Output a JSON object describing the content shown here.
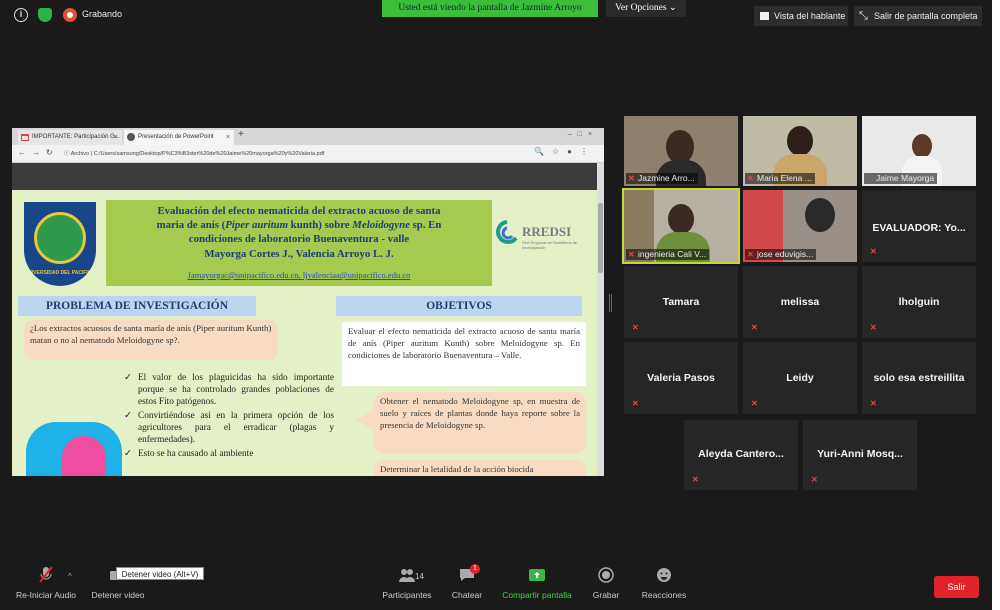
{
  "topbar": {
    "recording_label": "Grabando",
    "share_banner": "Usted está viendo la pantalla de Jazmine Arroyo",
    "view_options": "Ver Opciones",
    "speaker_view": "Vista del hablante",
    "exit_fullscreen": "Salir de pantalla completa"
  },
  "browser": {
    "tabs": [
      {
        "label": "IMPORTANTE: Participación G..."
      },
      {
        "label": "Presentación de PowerPoint"
      }
    ],
    "url_prefix": "Archivo",
    "url": "C:/Users/samsung/Desktop/P%C3%B3ster%20de%20Jaime%20mayorga%20y%20Valeria.pdf"
  },
  "poster": {
    "logo_text": "UNIVERSIDAD DEL PACIFICO",
    "title_line1": "Evaluación del efecto nematicida del extracto acuoso de santa",
    "title_line2_pre": "maria de anís (",
    "title_line2_em": "Piper auritum",
    "title_line2_mid": " kunth) sobre ",
    "title_line2_em2": "Meloidogyne",
    "title_line2_post": " sp. En",
    "title_line3": "condiciones de laboratorio Buenaventura - valle",
    "title_line4": "Mayorga Cortes J., Valencia Arroyo L. J.",
    "emails": "Jamayorgac@unipacifico.edu.co, ljvalenciaa@unipacifico.edu.co",
    "partner_logo": "RREDSI",
    "partner_sub": "Red Regional de Semilleros de Investigación",
    "problem_heading": "PROBLEMA DE INVESTIGACIÓN",
    "objectives_heading": "OBJETIVOS",
    "question": "¿Los extractos acuosos de santa maría de anís (Piper auritum Kunth) matan o no al nematodo Meloidogyne sp?.",
    "bullets": [
      "El valor de los plaguicidas ha sido importante porque se ha controlado grandes poblaciones de estos Fito patógenos.",
      "Convirtiéndose así en la primera opción de los agricultores para el erradicar (plagas y enfermedades).",
      "Esto se ha causado al ambiente"
    ],
    "objective_general": "Evaluar el efecto nematicida del extracto acuoso de santa maría de anís (Piper auritum Kunth) sobre Meloidogyne sp. En condiciones de laboratorio Buenaventura – Valle.",
    "objective_1": "Obtener el nematodo Meloidogyne sp, en muestra de suelo y raíces de plantas donde haya reporte sobre la presencia de Meloidogyne sp.",
    "objective_2": "Determinar la letalidad de la acción biocida"
  },
  "participants": {
    "video": [
      {
        "name": "Jazmine Arro..."
      },
      {
        "name": "Maria Elena ..."
      },
      {
        "name": "Jaime Mayorga"
      },
      {
        "name": "ingenieria Cali V..."
      },
      {
        "name": "jose eduvigis..."
      }
    ],
    "names": [
      "EVALUADOR: Yo...",
      "Tamara",
      "melissa",
      "lholguin",
      "Valeria Pasos",
      "Leidy",
      "solo esa estreillita",
      "Aleyda  Cantero...",
      "Yuri-Anni  Mosq..."
    ]
  },
  "toolbar": {
    "audio": "Re-Iniciar Audio",
    "video": "Detener video",
    "tooltip": "Detener video (Alt+V)",
    "participants": "Participantes",
    "participants_count": "14",
    "chat": "Chatear",
    "chat_badge": "1",
    "share": "Compartir pantalla",
    "record": "Grabar",
    "reactions": "Reacciones",
    "leave": "Salir"
  },
  "colors": {
    "banner": "#3bbf3b",
    "leave": "#e0222a",
    "share_icon": "#3bb54a",
    "active_speaker": "#c8d63a"
  }
}
